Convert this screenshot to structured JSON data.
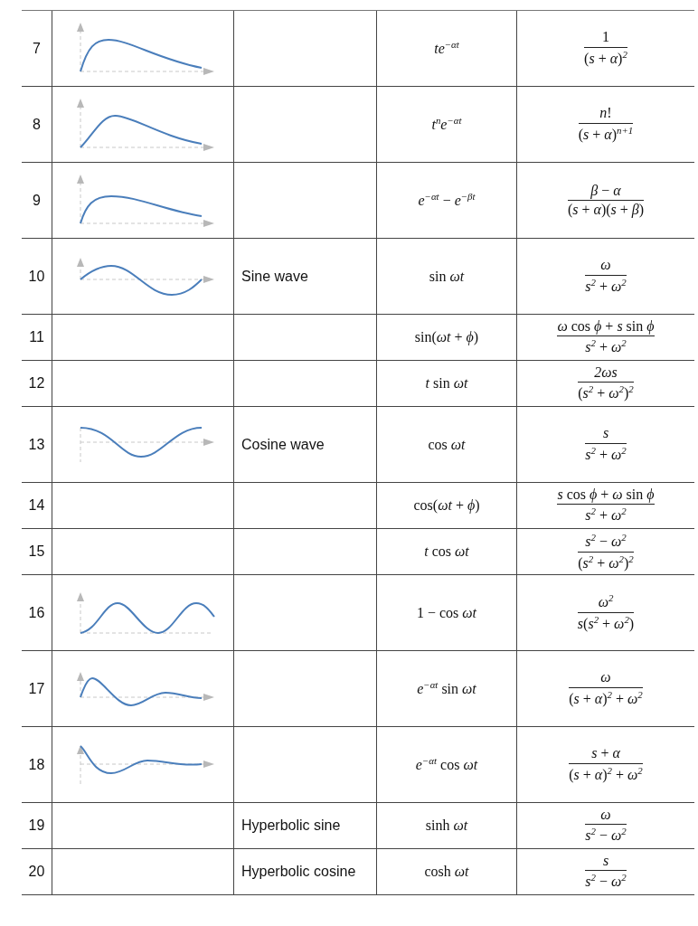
{
  "rows": [
    {
      "number": "7",
      "graph": {
        "kind": "alpha-pulse"
      },
      "time_function": "*te*$^{−αt}$",
      "transform": {
        "numerator": "1",
        "denominator": "(*s* + *α*)$^{2}$"
      }
    },
    {
      "number": "8",
      "graph": {
        "kind": "power-pulse"
      },
      "time_function": "*t*$^{n}$*e*$^{−αt}$",
      "transform": {
        "numerator": "*n*!",
        "denominator": "(*s* + *α*)$^{n+1}$"
      }
    },
    {
      "number": "9",
      "graph": {
        "kind": "difference-pulse"
      },
      "time_function": "*e*$^{−αt}$ − *e*$^{−βt}$",
      "transform": {
        "numerator": "*β* − *α*",
        "denominator": "(*s* + *α*)(*s* + *β*)"
      }
    },
    {
      "number": "10",
      "graph": {
        "kind": "sine"
      },
      "description": "Sine wave",
      "time_function": "sin *ωt*",
      "transform": {
        "numerator": "*ω*",
        "denominator": "*s*$^{2}$ + *ω*$^{2}$"
      }
    },
    {
      "number": "11",
      "time_function": "sin(*ωt* + *ϕ*)",
      "transform": {
        "numerator": "*ω* cos *ϕ* + *s* sin *ϕ*",
        "denominator": "*s*$^{2}$ + *ω*$^{2}$"
      }
    },
    {
      "number": "12",
      "time_function": "*t* sin *ωt*",
      "transform": {
        "numerator": "*2ωs*",
        "denominator": "(*s*$^{2}$ + *ω*$^{2}$)$^{2}$"
      }
    },
    {
      "number": "13",
      "graph": {
        "kind": "cosine"
      },
      "description": "Cosine wave",
      "time_function": "cos *ωt*",
      "transform": {
        "numerator": "*s*",
        "denominator": "*s*$^{2}$ + *ω*$^{2}$"
      }
    },
    {
      "number": "14",
      "time_function": "cos(*ωt* + *ϕ*)",
      "transform": {
        "numerator": "*s* cos *ϕ* + *ω* sin *ϕ*",
        "denominator": "*s*$^{2}$ + *ω*$^{2}$"
      }
    },
    {
      "number": "15",
      "time_function": "*t* cos *ωt*",
      "transform": {
        "numerator": "*s*$^{2}$ − *ω*$^{2}$",
        "denominator": "(*s*$^{2}$ + *ω*$^{2}$)$^{2}$"
      }
    },
    {
      "number": "16",
      "graph": {
        "kind": "one-minus-cosine"
      },
      "time_function": "1 − cos *ωt*",
      "transform": {
        "numerator": "*ω*$^{2}$",
        "denominator": "*s*(*s*$^{2}$ + *ω*$^{2}$)"
      }
    },
    {
      "number": "17",
      "graph": {
        "kind": "damped-sine"
      },
      "time_function": "*e*$^{−αt}$ sin *ωt*",
      "transform": {
        "numerator": "*ω*",
        "denominator": "(*s* + *α*)$^{2}$ + *ω*$^{2}$"
      }
    },
    {
      "number": "18",
      "graph": {
        "kind": "damped-cosine"
      },
      "time_function": "*e*$^{−αt}$ cos *ωt*",
      "transform": {
        "numerator": "*s* + *α*",
        "denominator": "(*s* + *α*)$^{2}$ + *ω*$^{2}$"
      }
    },
    {
      "number": "19",
      "description": "Hyperbolic sine",
      "time_function": "sinh *ωt*",
      "transform": {
        "numerator": "*ω*",
        "denominator": "*s*$^{2}$ − *ω*$^{2}$"
      }
    },
    {
      "number": "20",
      "description": "Hyperbolic cosine",
      "time_function": "cosh *ωt*",
      "transform": {
        "numerator": "*s*",
        "denominator": "*s*$^{2}$ − *ω*$^{2}$"
      }
    }
  ]
}
